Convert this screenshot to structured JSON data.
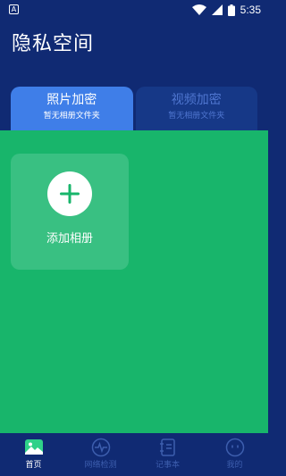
{
  "status_bar": {
    "notification_letter": "A",
    "time": "5:35"
  },
  "app": {
    "title": "隐私空间"
  },
  "tabs": [
    {
      "label": "照片加密",
      "sub": "暂无相册文件夹",
      "active": true
    },
    {
      "label": "视频加密",
      "sub": "暂无相册文件夹",
      "active": false
    }
  ],
  "album": {
    "add_label": "添加相册",
    "icon": "plus-icon"
  },
  "bottom_nav": [
    {
      "label": "首页",
      "icon": "home-image-icon",
      "active": true
    },
    {
      "label": "网络检测",
      "icon": "network-pulse-icon",
      "active": false
    },
    {
      "label": "记事本",
      "icon": "notebook-icon",
      "active": false
    },
    {
      "label": "我的",
      "icon": "profile-face-icon",
      "active": false
    }
  ],
  "colors": {
    "header_bg": "#102a73",
    "active_tab": "#3f7ee8",
    "inactive_tab": "#163887",
    "content_bg": "#18b56b",
    "card_bg": "#39c082"
  }
}
